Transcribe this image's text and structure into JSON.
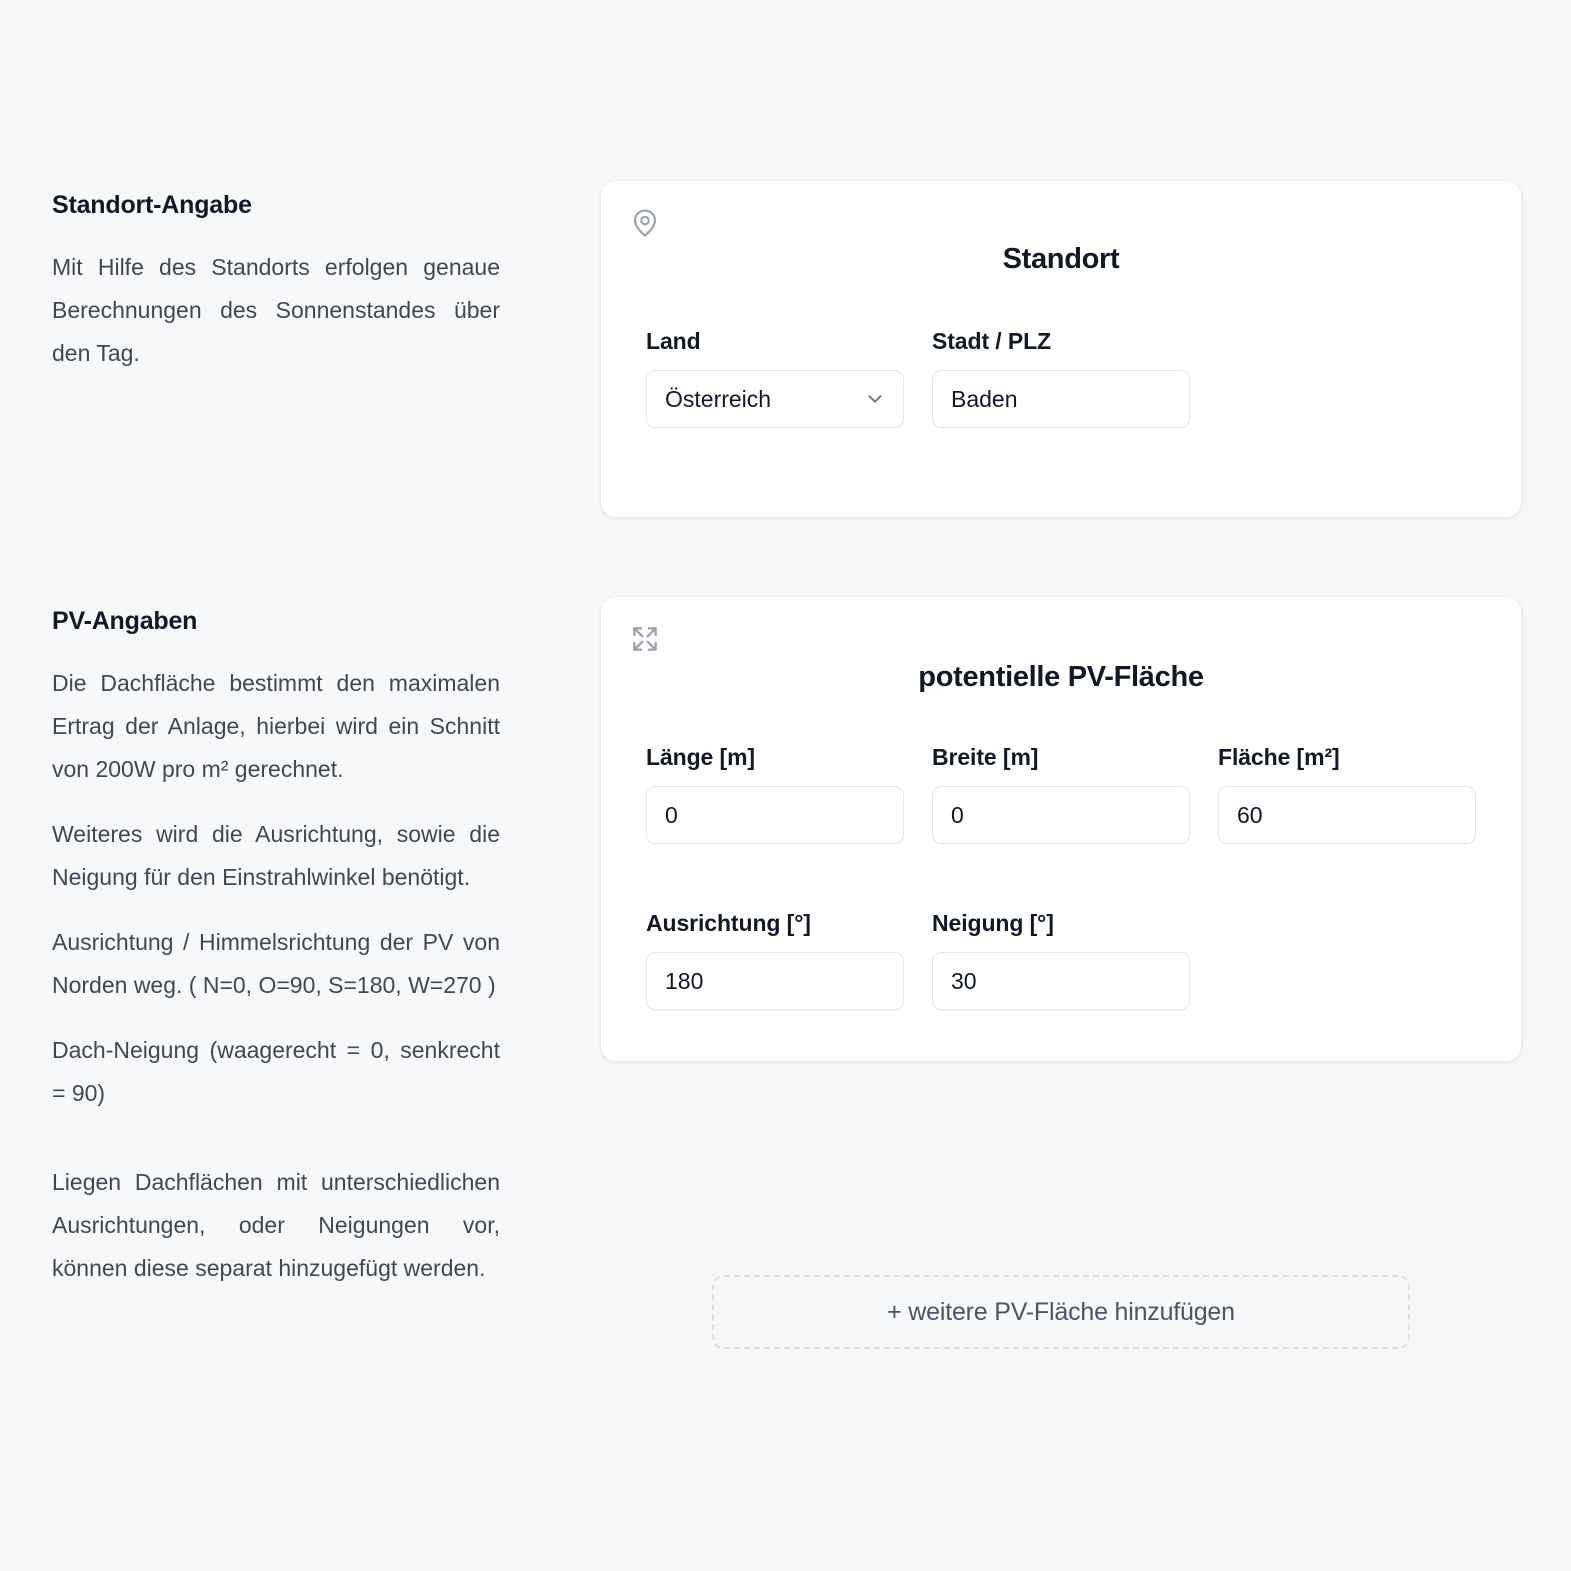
{
  "theme": {
    "background": "#f6f8f9",
    "card_background": "#ffffff",
    "border": "#e3e6ea",
    "text_primary": "#111827",
    "text_secondary": "#3f4854",
    "icon_gray": "#9aa1ac"
  },
  "location_info": {
    "title": "Standort-Angabe",
    "paragraphs": [
      "Mit Hilfe des Standorts erfolgen genaue Berechnungen des Sonnenstandes über den Tag."
    ]
  },
  "pv_info": {
    "title": "PV-Angaben",
    "paragraphs": [
      "Die Dachfläche bestimmt den maximalen Ertrag der Anlage, hierbei wird ein Schnitt von 200W pro m² gerechnet.",
      "Weiteres wird die Ausrichtung, sowie die Neigung für den Einstrahlwinkel benötigt.",
      "Ausrichtung / Himmelsrichtung der PV von Norden weg. ( N=0, O=90, S=180, W=270 )",
      "Dach-Neigung (waagerecht = 0, senkrecht = 90)"
    ],
    "note": "Liegen Dachflächen mit unterschiedlichen Ausrichtungen, oder Neigungen vor, können diese separat hinzugefügt werden."
  },
  "location_card": {
    "icon": "map-pin-icon",
    "title": "Standort",
    "fields": [
      {
        "label": "Land",
        "type": "select",
        "value": "Österreich",
        "options": [
          "Österreich"
        ],
        "icon": "chevron-down-icon"
      },
      {
        "label": "Stadt / PLZ",
        "type": "text",
        "value": "Baden",
        "placeholder": "Stadt / PLZ"
      }
    ]
  },
  "pv_card": {
    "icon": "maximize-icon",
    "title": "potentielle PV-Fläche",
    "row1": [
      {
        "label": "Länge [m]",
        "type": "text",
        "value": "0",
        "placeholder": "0"
      },
      {
        "label": "Breite [m]",
        "type": "text",
        "value": "0",
        "placeholder": "0"
      },
      {
        "label": "Fläche [m²]",
        "type": "text",
        "value": "60",
        "placeholder": "0"
      }
    ],
    "row2": [
      {
        "label": "Ausrichtung [°]",
        "type": "text",
        "value": "180",
        "placeholder": "0"
      },
      {
        "label": "Neigung [°]",
        "type": "text",
        "value": "30",
        "placeholder": "0"
      }
    ]
  },
  "add_button": {
    "label": "+ weitere PV-Fläche hinzufügen"
  }
}
